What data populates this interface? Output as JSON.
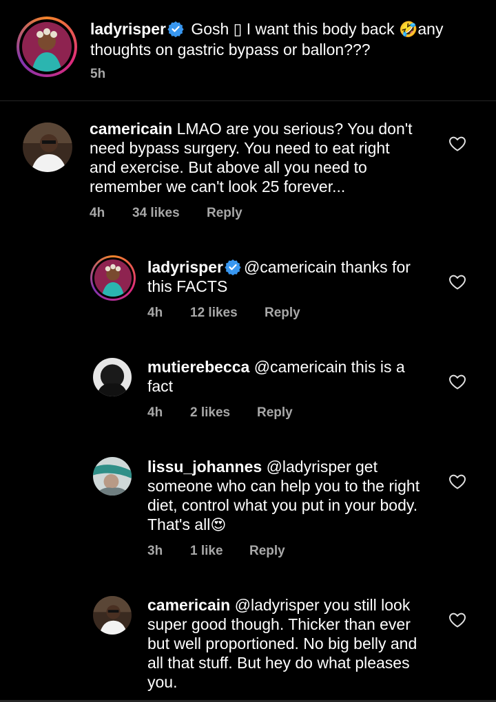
{
  "caption": {
    "username": "ladyrisper",
    "text_1": " Gosh ",
    "text_2": " I want this body back ",
    "text_3": "any thoughts on gastric bypass or ballon???",
    "emoji_box": "▯",
    "emoji_rofl": "🤣",
    "time": "5h"
  },
  "comments": [
    {
      "username": "camericain",
      "text": " LMAO are you serious? You don't need bypass surgery. You need to eat right and exercise. But above all you need to remember we can't look 25 forever...",
      "time": "4h",
      "likes": "34 likes",
      "reply": "Reply"
    },
    {
      "username": "ladyrisper",
      "mention": "@camericain",
      "text": " thanks for this FACTS",
      "time": "4h",
      "likes": "12 likes",
      "reply": "Reply"
    },
    {
      "username": "mutierebecca",
      "mention": "@camericain",
      "text": " this is a fact",
      "time": "4h",
      "likes": "2 likes",
      "reply": "Reply"
    },
    {
      "username": "lissu_johannes",
      "mention": "@ladyrisper",
      "text": "  get someone who can help you to the right diet, control what you put in your body. That's all",
      "emoji": "😍",
      "time": "3h",
      "likes": "1 like",
      "reply": "Reply"
    },
    {
      "username": "camericain",
      "mention": "@ladyrisper",
      "text": " you still look super good though. Thicker than ever but well proportioned. No big belly and all that stuff. But hey do what pleases you."
    }
  ],
  "colors": {
    "background": "#000000",
    "text": "#ffffff",
    "meta": "#a8a8a8",
    "verified": "#3897f0",
    "divider": "#262626"
  },
  "icons": [
    "verified-badge-icon",
    "heart-outline-icon"
  ]
}
